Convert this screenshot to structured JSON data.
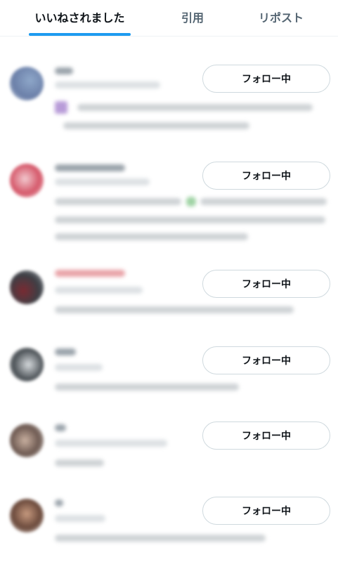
{
  "tabs": [
    {
      "label": "いいねされました",
      "active": true
    },
    {
      "label": "引用",
      "active": false
    },
    {
      "label": "リポスト",
      "active": false
    }
  ],
  "colors": {
    "accent": "#1d9bf0",
    "border": "#cfd9de"
  },
  "users": [
    {
      "button_label": "フォロー中"
    },
    {
      "button_label": "フォロー中"
    },
    {
      "button_label": "フォロー中"
    },
    {
      "button_label": "フォロー中"
    },
    {
      "button_label": "フォロー中"
    },
    {
      "button_label": "フォロー中"
    }
  ]
}
